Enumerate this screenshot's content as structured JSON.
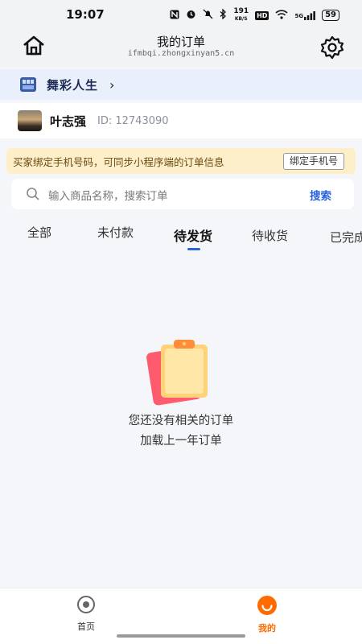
{
  "status_bar": {
    "time": "19:07",
    "network_speed_top": "191",
    "network_speed_unit": "KB/S",
    "hd_label": "HD",
    "signal_label": "5G",
    "battery": "59"
  },
  "header": {
    "title": "我的订单",
    "domain": "ifmbqi.zhongxinyan5.cn"
  },
  "shop": {
    "name": "舞彩人生",
    "chevron": "›"
  },
  "user": {
    "name": "叶志强",
    "id_text": "ID: 12743090"
  },
  "notice": {
    "text": "买家绑定手机号码，可同步小程序端的订单信息",
    "bind_label": "绑定手机号"
  },
  "search": {
    "placeholder": "输入商品名称，搜索订单",
    "button_label": "搜索"
  },
  "tabs": [
    {
      "label": "全部"
    },
    {
      "label": "未付款"
    },
    {
      "label": "待发货"
    },
    {
      "label": "待收货"
    },
    {
      "label": "已完成"
    }
  ],
  "active_tab": "待发货",
  "empty": {
    "line1": "您还没有相关的订单",
    "line2": "加载上一年订单"
  },
  "bottom_nav": [
    {
      "label": "首页"
    },
    {
      "label": "我的"
    }
  ],
  "colors": {
    "accent": "#2a64e0",
    "active_nav": "#ff6b00",
    "notice_bg": "#fdefc9"
  }
}
